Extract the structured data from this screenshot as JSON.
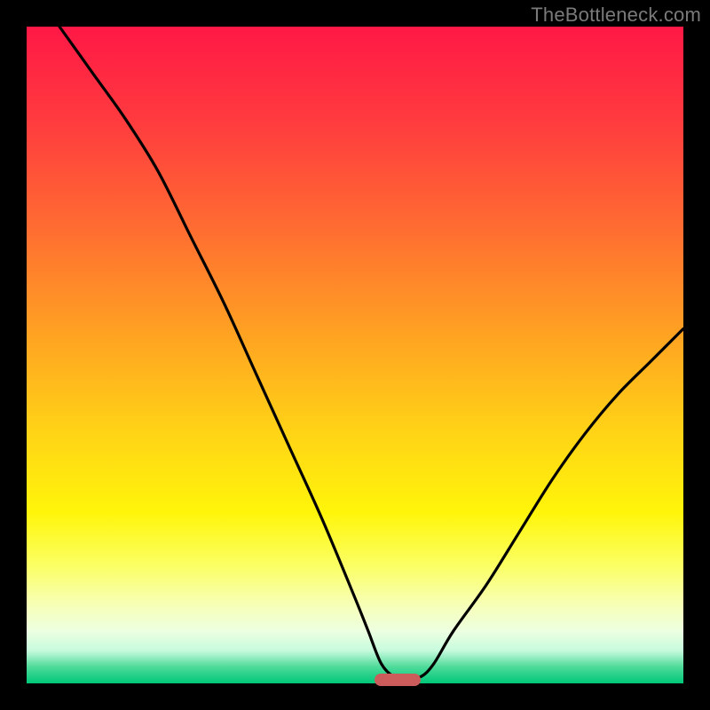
{
  "attribution": "TheBottleneck.com",
  "chart_data": {
    "type": "line",
    "title": "",
    "xlabel": "",
    "ylabel": "",
    "xlim": [
      0,
      100
    ],
    "ylim": [
      0,
      100
    ],
    "curve": {
      "x": [
        5,
        10,
        15,
        20,
        25,
        30,
        35,
        40,
        45,
        50,
        52,
        54,
        56,
        58,
        60,
        62,
        65,
        70,
        75,
        80,
        85,
        90,
        95,
        100
      ],
      "y": [
        100,
        93,
        86,
        78,
        68,
        58,
        47,
        36,
        25,
        13,
        8,
        3,
        1,
        1,
        1,
        3,
        8,
        15,
        23,
        31,
        38,
        44,
        49,
        54
      ]
    },
    "marker": {
      "x_start": 53,
      "x_end": 60,
      "y": 0.5
    },
    "colors": {
      "gradient_top": "#ff1846",
      "gradient_mid": "#ffd416",
      "gradient_bottom": "#00c87a",
      "curve": "#000000",
      "marker": "#cc5b5b",
      "frame": "#000000"
    }
  }
}
